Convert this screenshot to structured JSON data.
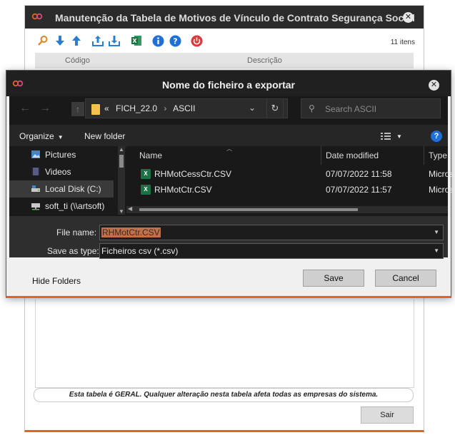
{
  "bg_window": {
    "title": "Manutenção da Tabela de Motivos de Vínculo de Contrato Segurança Social",
    "close_glyph": "✕",
    "items_count": "11 itens",
    "columns": [
      "Código",
      "Descrição"
    ],
    "notice": "Esta tabela é GERAL. Qualquer alteração nesta tabela afeta todas as empresas do sistema.",
    "exit_label": "Sair",
    "toolbar_icons": [
      "search-icon",
      "arrow-down-icon",
      "arrow-up-icon",
      "upload-icon",
      "download-icon",
      "excel-icon",
      "info-icon",
      "help-icon",
      "power-icon"
    ],
    "brand_color": "#e8621c"
  },
  "dialog": {
    "title": "Nome do ficheiro a exportar",
    "close_glyph": "✕",
    "path": {
      "prefix": "«",
      "segments": [
        "FICH_22.0",
        "ASCII"
      ]
    },
    "search_placeholder": "Search ASCII",
    "commands": {
      "organize": "Organize",
      "new_folder": "New folder"
    },
    "tree": [
      {
        "label": "Pictures",
        "icon": "pictures-icon"
      },
      {
        "label": "Videos",
        "icon": "videos-icon"
      },
      {
        "label": "Local Disk (C:)",
        "icon": "drive-icon",
        "selected": true
      },
      {
        "label": "soft_ti (\\\\artsoft)",
        "icon": "network-drive-icon"
      }
    ],
    "columns": {
      "name": "Name",
      "date": "Date modified",
      "type": "Type"
    },
    "files": [
      {
        "name": "RHMotCessCtr.CSV",
        "date": "07/07/2022 11:58",
        "type": "Micros"
      },
      {
        "name": "RHMotCtr.CSV",
        "date": "07/07/2022 11:57",
        "type": "Micros"
      }
    ],
    "file_name_label": "File name:",
    "file_name_value": "RHMotCtr.CSV",
    "save_type_label": "Save as type:",
    "save_type_value": "Ficheiros csv (*.csv)",
    "hide_folders": "Hide Folders",
    "save_label": "Save",
    "cancel_label": "Cancel"
  }
}
